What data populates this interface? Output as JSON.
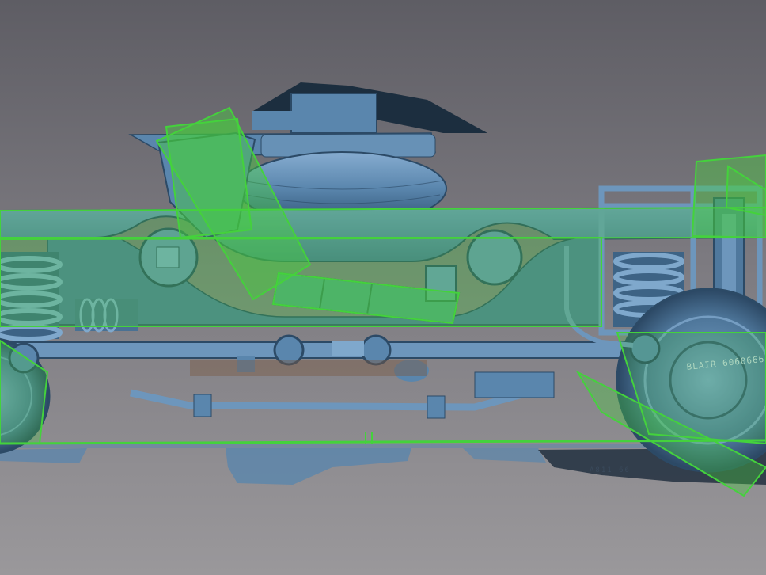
{
  "scene": {
    "subject": "point-cloud-scan",
    "colors": {
      "background_top": "#5e5d64",
      "background_bottom": "#9a989b",
      "scan_blue": "#5a86ad",
      "scan_blue_dark": "#2c4a66",
      "scan_blue_light": "#7fa8cc",
      "overlay_green": "#44d23c",
      "overlay_green_fill": "rgba(70, 210, 60, 0.45)",
      "rust": "#7a5a44"
    }
  },
  "labels": {
    "wheel_stamp": "BLAIR 6060666",
    "ground_stamp": "A811 66"
  }
}
